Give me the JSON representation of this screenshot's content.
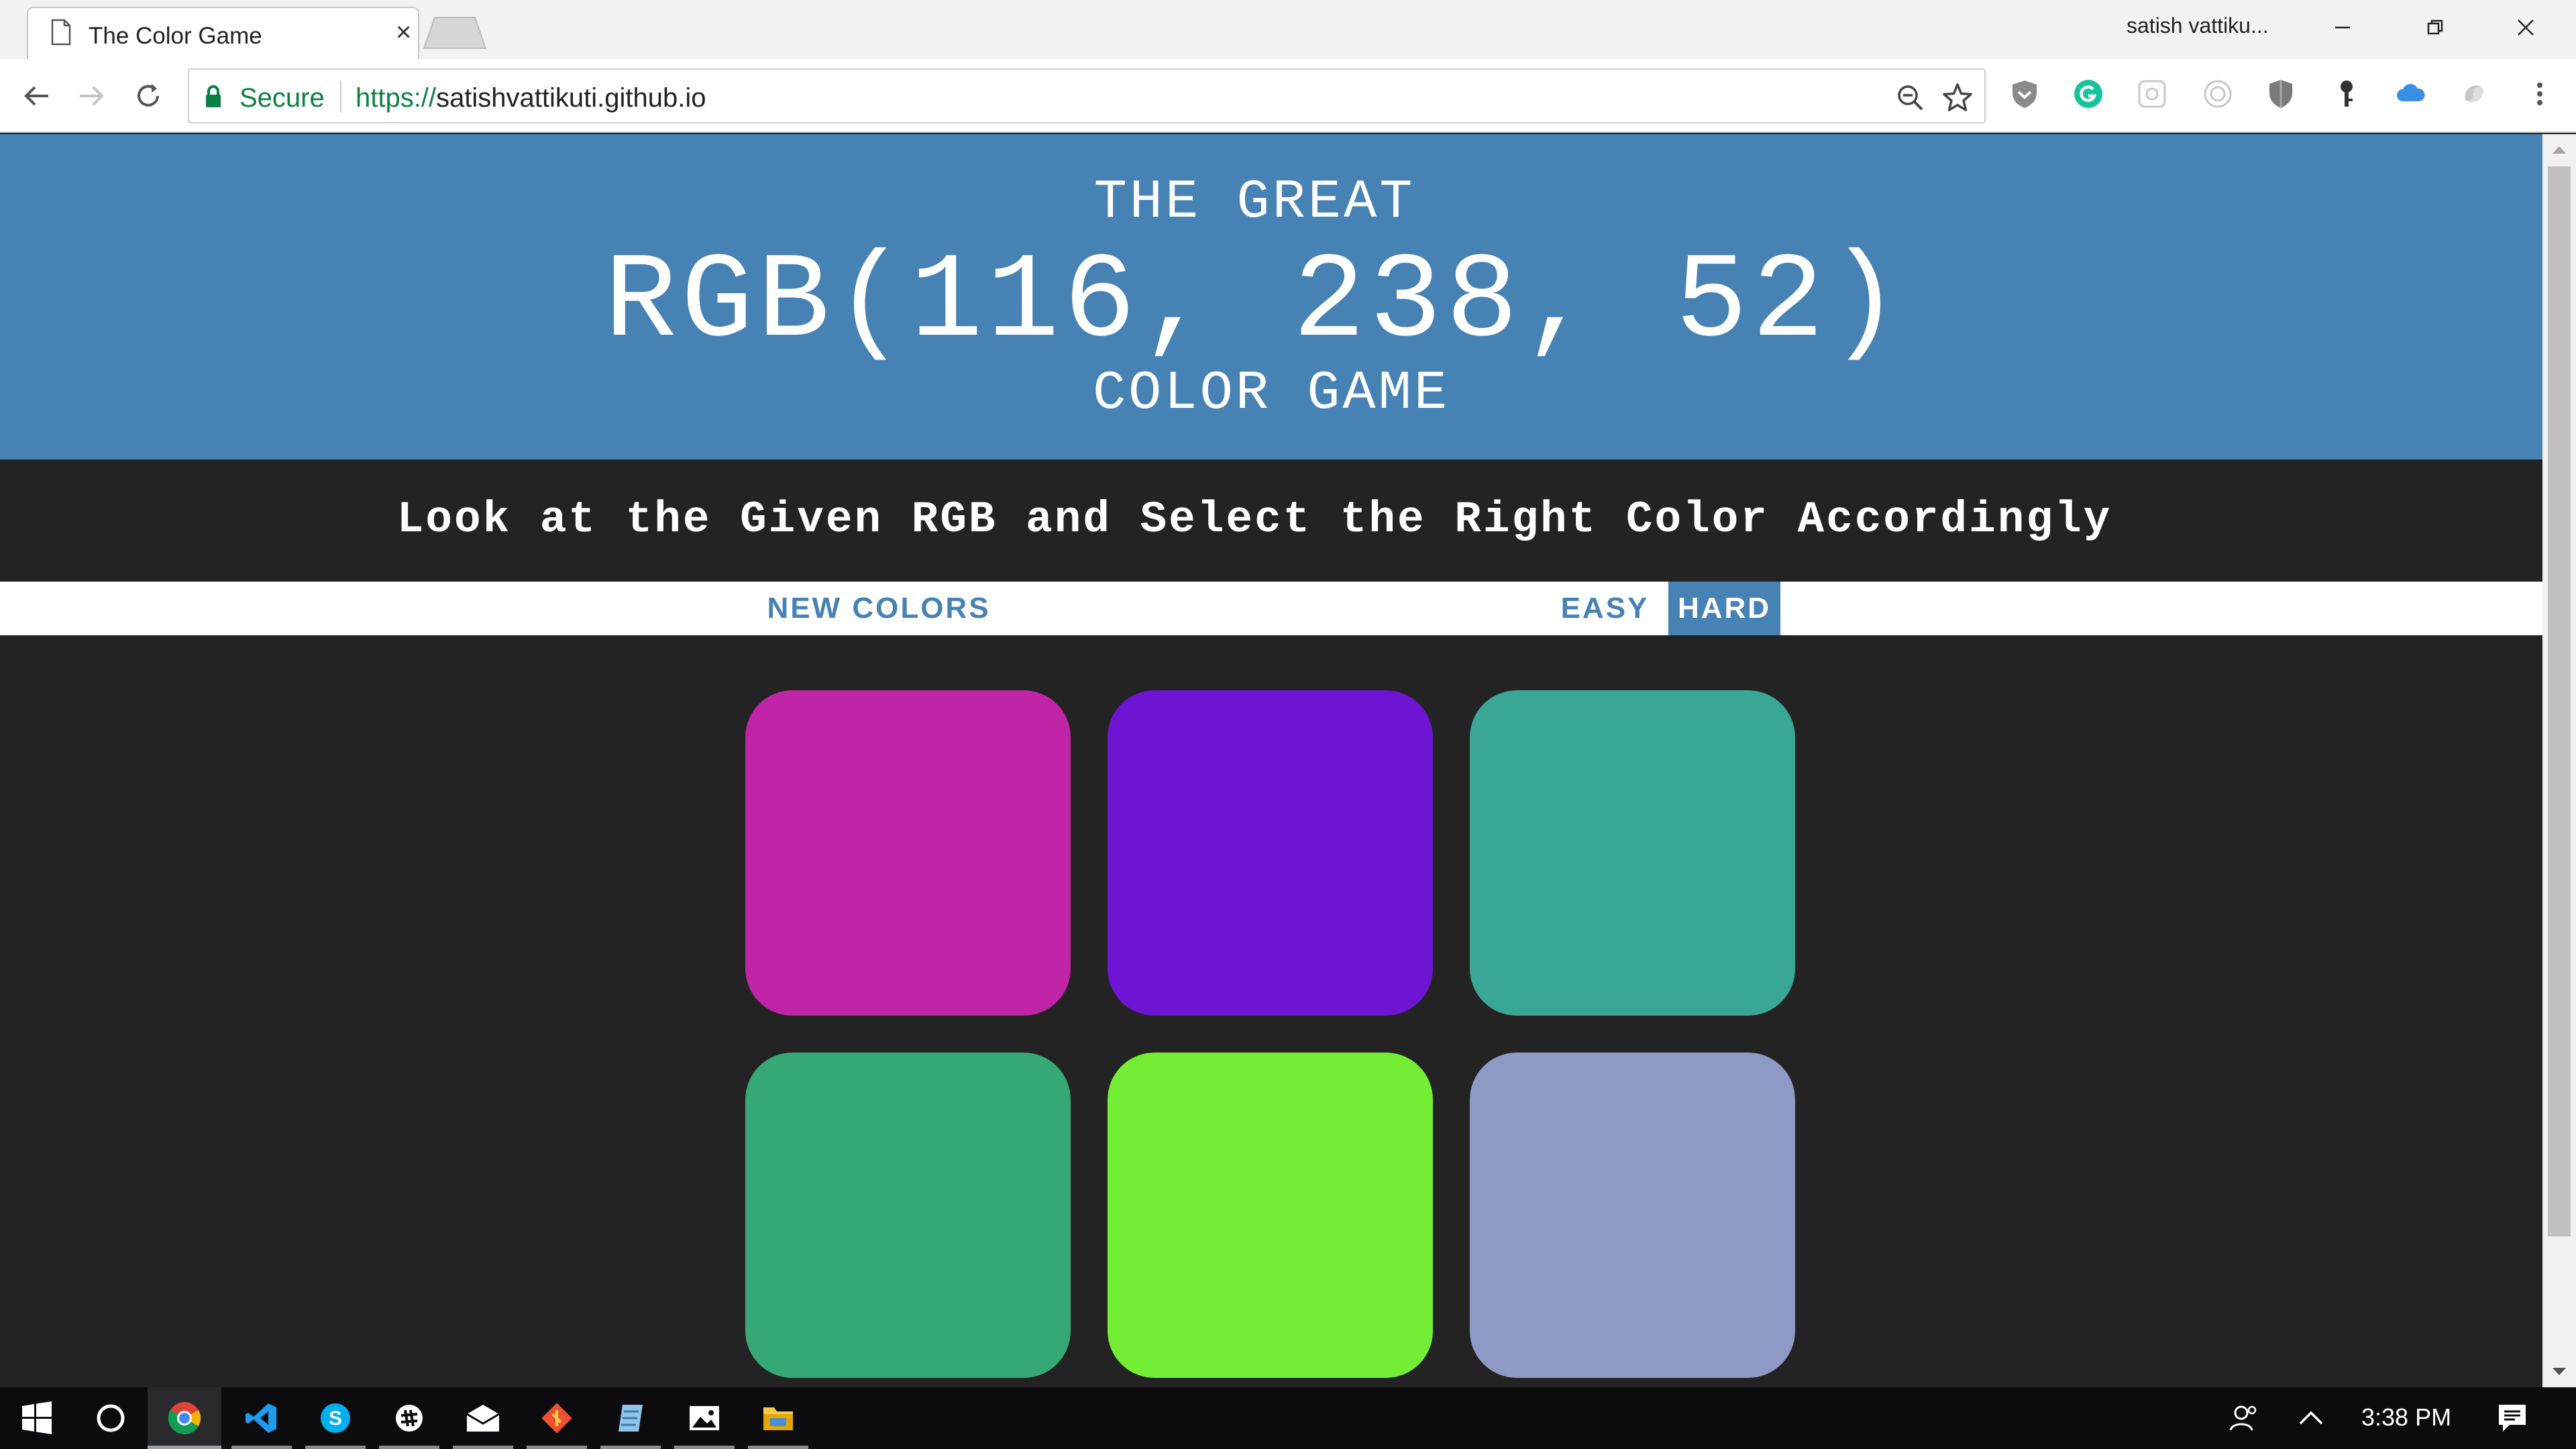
{
  "browser": {
    "tab_title": "The Color Game",
    "tab_close": "×",
    "profile_name": "satish vattiku...",
    "secure_label": "Secure",
    "url_scheme": "https://",
    "url_host": "satishvattikuti.github.io"
  },
  "game": {
    "header_line1": "THE GREAT",
    "rgb_display": "RGB(116, 238, 52)",
    "header_line3": "COLOR GAME",
    "instruction": "Look at the Given RGB and Select the Right Color Accordingly",
    "new_colors_label": "NEW COLORS",
    "easy_label": "EASY",
    "hard_label": "HARD",
    "mode_selected": "HARD",
    "squares": [
      {
        "color": "#c025a7"
      },
      {
        "color": "#6d15d2"
      },
      {
        "color": "#3aa696"
      },
      {
        "color": "#35a875"
      },
      {
        "color": "#74ee34"
      },
      {
        "color": "#8f99c6"
      }
    ]
  },
  "taskbar": {
    "clock": "3:38 PM",
    "apps": [
      "start-icon",
      "cortana-icon",
      "chrome-icon",
      "vscode-icon",
      "skype-icon",
      "slack-icon",
      "mail-icon",
      "git-icon",
      "notes-icon",
      "photos-icon",
      "file-explorer-icon"
    ]
  },
  "colors": {
    "header_bg": "#4682b4",
    "page_bg": "#232323",
    "accent": "#4682b4"
  }
}
